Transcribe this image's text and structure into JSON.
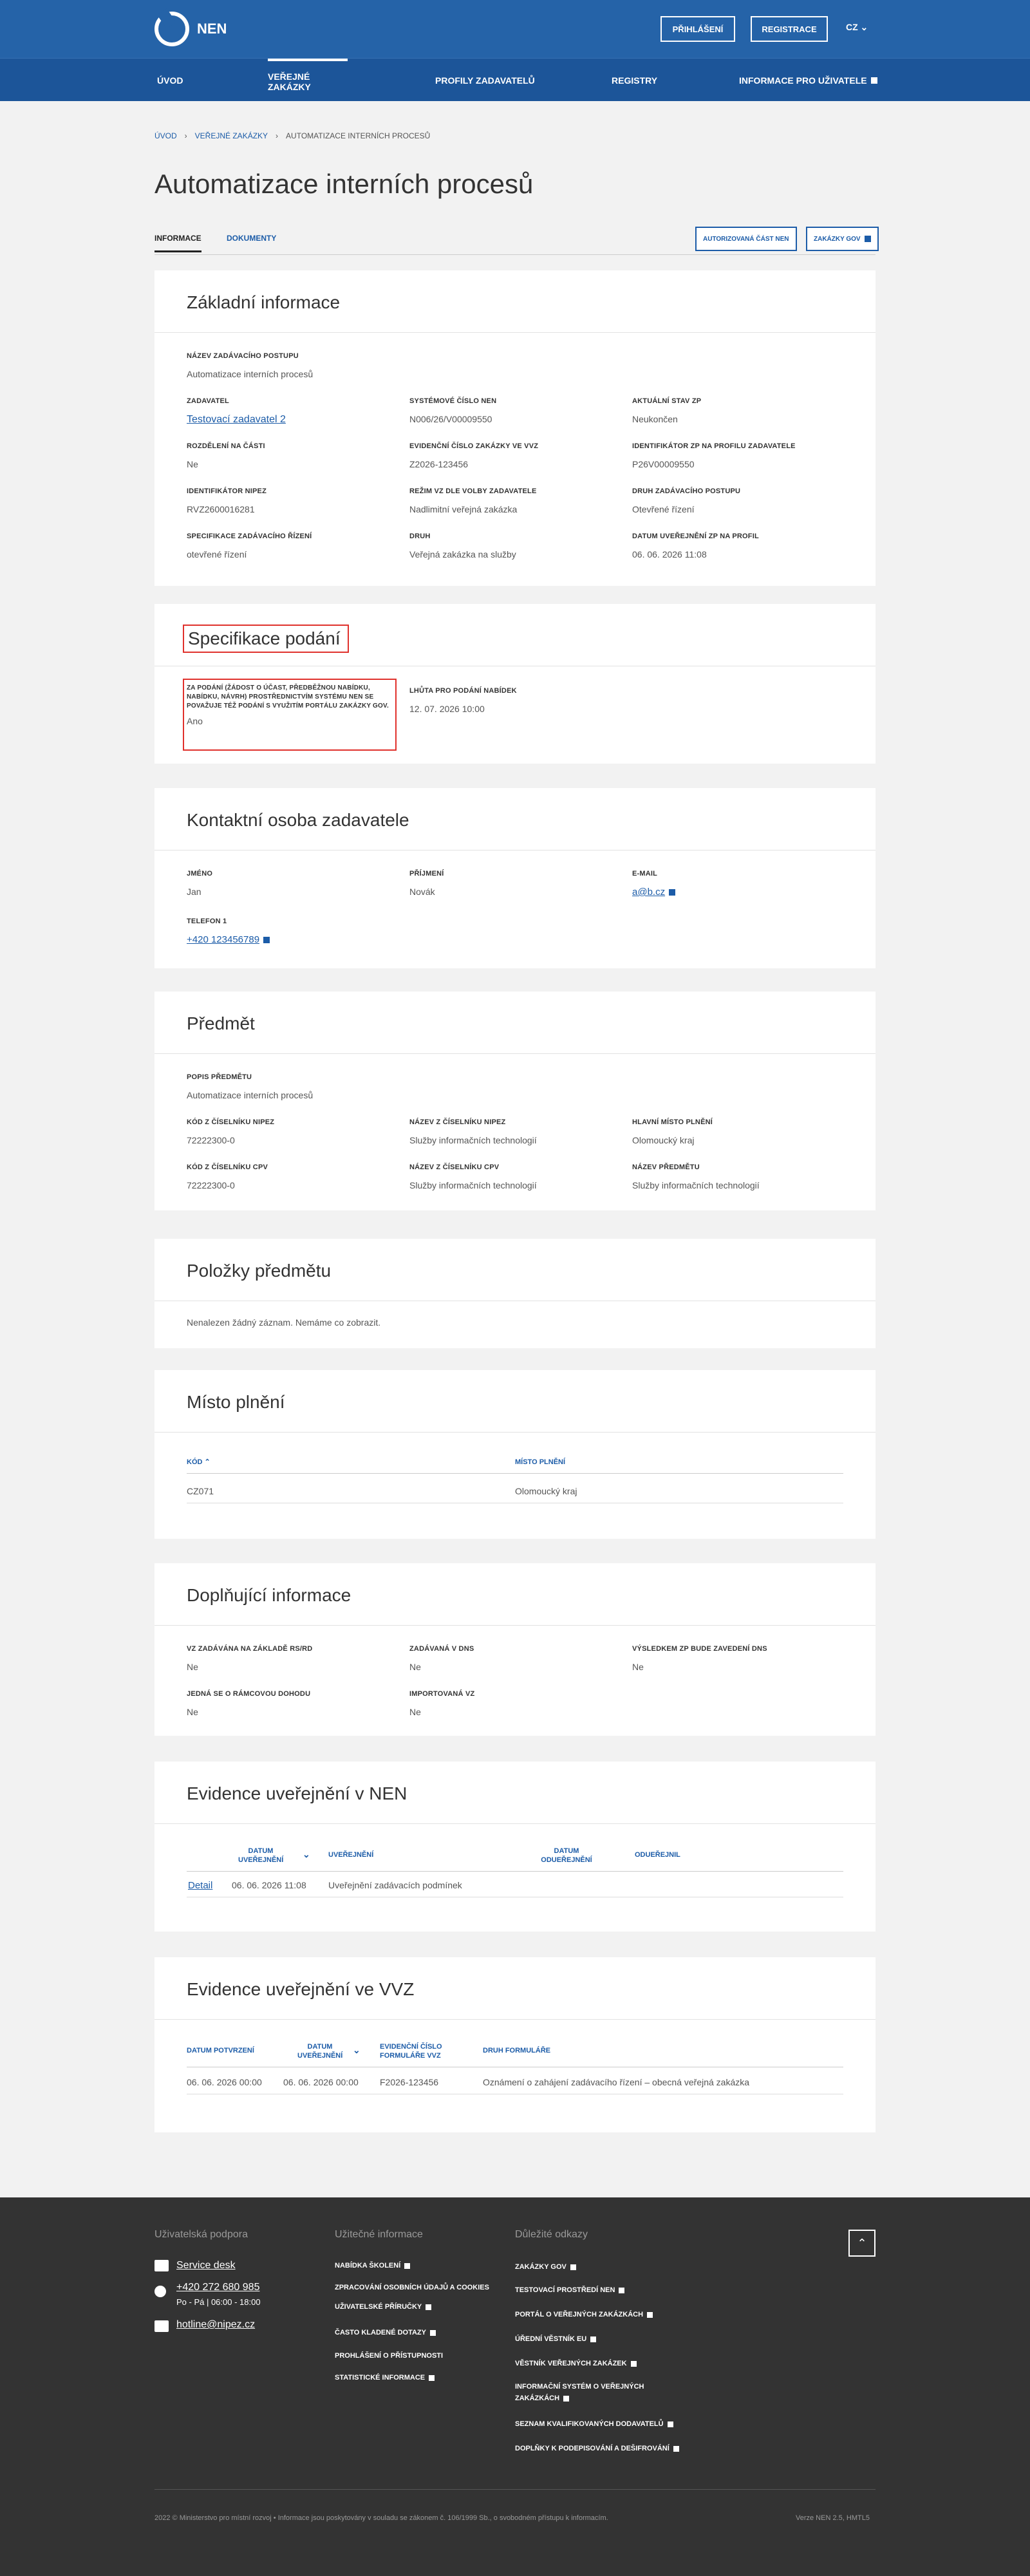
{
  "header": {
    "logo_text": "NEN",
    "login": "Přihlášení",
    "register": "Registrace",
    "lang": "CZ ⌄"
  },
  "nav": [
    "Úvod",
    "Veřejné zakázky",
    "Profily zadavatelů",
    "Registry",
    "Informace pro uživatele"
  ],
  "breadcrumb": [
    "Úvod",
    "Veřejné zakázky",
    "Automatizace interních procesů"
  ],
  "title": "Automatizace interních procesů",
  "tabs": [
    "Informace",
    "Dokumenty"
  ],
  "tab_buttons": [
    "Autorizovaná část NEN",
    "Zakázky GOV"
  ],
  "basic": {
    "title": "Základní informace",
    "name_l": "Název zadávacího postupu",
    "name_v": "Automatizace interních procesů",
    "f": [
      [
        "Zadavatel",
        "Testovací zadavatel 2"
      ],
      [
        "Systémové číslo NEN",
        "N006/26/V00009550"
      ],
      [
        "Aktuální stav ZP",
        "Neukončen"
      ],
      [
        "Rozdělení na části",
        "Ne"
      ],
      [
        "Evidenční číslo zakázky ve VVZ",
        "Z2026-123456"
      ],
      [
        "Identifikátor ZP na profilu zadavatele",
        "P26V00009550"
      ],
      [
        "Identifikátor NIPEZ",
        "RVZ2600016281"
      ],
      [
        "Režim VZ dle volby zadavatele",
        "Nadlimitní veřejná zakázka"
      ],
      [
        "Druh zadávacího postupu",
        "Otevřené řízení"
      ],
      [
        "Specifikace zadávacího řízení",
        "otevřené řízení"
      ],
      [
        "Druh",
        "Veřejná zakázka na služby"
      ],
      [
        "Datum uveřejnění ZP na profil",
        "06. 06. 2026 11:08"
      ]
    ]
  },
  "spec": {
    "title": "Specifikace podání",
    "l1": "Za podání (žádost o účast, předběžnou nabídku, nabídku, návrh) prostřednictvím systému NEN se považuje též podání s využitím portálu Zakázky GOV.",
    "v1": "Ano",
    "l2": "Lhůta pro podání nabídek",
    "v2": "12. 07. 2026 10:00"
  },
  "contact": {
    "title": "Kontaktní osoba zadavatele",
    "f": [
      [
        "Jméno",
        "Jan"
      ],
      [
        "Příjmení",
        "Novák"
      ],
      [
        "E-mail",
        "a@b.cz"
      ]
    ],
    "phone_l": "Telefon 1",
    "phone_v": "+420 123456789"
  },
  "subject": {
    "title": "Předmět",
    "desc_l": "Popis předmětu",
    "desc_v": "Automatizace interních procesů",
    "f": [
      [
        "Kód z číselníku NIPEZ",
        "72222300-0"
      ],
      [
        "Název z číselníku NIPEZ",
        "Služby informačních technologií"
      ],
      [
        "Hlavní místo plnění",
        "Olomoucký kraj"
      ],
      [
        "Kód z číselníku CPV",
        "72222300-0"
      ],
      [
        "Název z číselníku CPV",
        "Služby informačních technologií"
      ],
      [
        "Název předmětu",
        "Služby informačních technologií"
      ]
    ]
  },
  "items": {
    "title": "Položky předmětu",
    "empty": "Nenalezen žádný záznam. Nemáme co zobrazit."
  },
  "place": {
    "title": "Místo plnění",
    "h1": "Kód ⌃",
    "h2": "Místo plnění",
    "r1": "CZ071",
    "r2": "Olomoucký kraj"
  },
  "extra": {
    "title": "Doplňující informace",
    "f": [
      [
        "VZ zadávána na základě RS/RD",
        "Ne"
      ],
      [
        "Zadávaná v DNS",
        "Ne"
      ],
      [
        "Výsledkem ZP bude zavedení DNS",
        "Ne"
      ],
      [
        "Jedná se o rámcovou dohodu",
        "Ne"
      ],
      [
        "Importovaná VZ",
        "Ne"
      ]
    ]
  },
  "nen": {
    "title": "Evidence uveřejnění v NEN",
    "h": [
      "Datum uveřejnění",
      "⌄",
      "Uveřejnění",
      "Datum odueřejnění",
      "Odueřejnil"
    ],
    "detail": "Detail",
    "date": "06. 06. 2026 11:08",
    "what": "Uveřejnění zadávacích podmínek"
  },
  "vvz": {
    "title": "Evidence uveřejnění ve VVZ",
    "h": [
      "Datum potvrzení",
      "Datum uveřejnění",
      "⌄",
      "Evidenční číslo formuláře VVZ",
      "Druh formuláře"
    ],
    "r": [
      "06. 06. 2026 00:00",
      "06. 06. 2026 00:00",
      "F2026-123456",
      "Oznámení o zahájení zadávacího řízení – obecná veřejná zakázka"
    ]
  },
  "footer": {
    "h": [
      "Uživatelská podpora",
      "Užitečné informace",
      "Důležité odkazy"
    ],
    "service": "Service desk",
    "phone": "+420 272 680 985",
    "hours": "Po - Pá | 06:00 - 18:00",
    "mail": "hotline@nipez.cz",
    "useful": [
      "Nabídka školení",
      "Zpracování osobních údajů a cookies",
      "Uživatelské příručky",
      "Často kladené dotazy",
      "Prohlášení o přístupnosti",
      "Statistické informace"
    ],
    "links": [
      "Zakázky GOV",
      "Testovací prostředí NEN",
      "Portál o veřejných zakázkách",
      "Úřední věstník EU",
      "Věstník veřejných zakázek",
      "Informační systém o veřejných zakázkách",
      "Seznam kvalifikovaných dodavatelů",
      "Doplňky k podepisování a dešifrování"
    ],
    "copy": "2022 © Ministerstvo pro místní rozvoj • Informace jsou poskytovány v souladu se zákonem č. 106/1999 Sb., o svobodném přístupu k informacím.",
    "version": "Verze NEN 2.5, HMTL5",
    "up": "⌃"
  }
}
